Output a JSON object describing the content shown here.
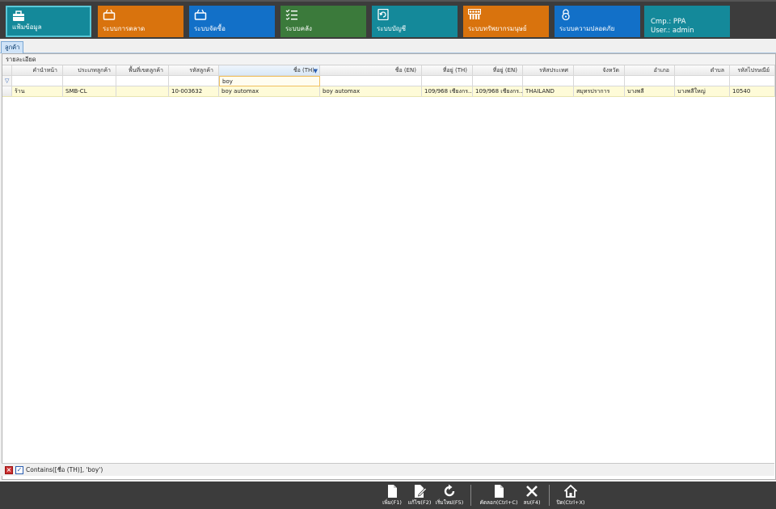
{
  "ribbon": {
    "tiles": [
      {
        "label": "แฟ้มข้อมูล",
        "icon": "briefcase-icon",
        "color": "#14899a"
      },
      {
        "label": "ระบบการตลาด",
        "icon": "basket-icon",
        "color": "#d9730d"
      },
      {
        "label": "ระบบจัดซื้อ",
        "icon": "basket-icon",
        "color": "#1270c8"
      },
      {
        "label": "ระบบคลัง",
        "icon": "checklist-icon",
        "color": "#3b7a3b"
      },
      {
        "label": "ระบบบัญชี",
        "icon": "refresh-doc-icon",
        "color": "#14899a"
      },
      {
        "label": "ระบบทรัพยากรมนุษย์",
        "icon": "people-icon",
        "color": "#d9730d"
      },
      {
        "label": "ระบบความปลอดภัย",
        "icon": "lock-icon",
        "color": "#1270c8"
      }
    ],
    "company": {
      "cmp": "Cmp.: PPA",
      "user": "User.: admin",
      "color": "#14899a"
    }
  },
  "tabs": [
    {
      "label": "ลูกค้า"
    }
  ],
  "group_caption": "รายละเอียด",
  "grid": {
    "columns": [
      {
        "label": "คำนำหน้า"
      },
      {
        "label": "ประเภทลูกค้า"
      },
      {
        "label": "พื้นที่เขตลูกค้า"
      },
      {
        "label": "รหัสลูกค้า"
      },
      {
        "label": "ชื่อ (TH)"
      },
      {
        "label": "ชื่อ (EN)"
      },
      {
        "label": "ที่อยู่ (TH)"
      },
      {
        "label": "ที่อยู่ (EN)"
      },
      {
        "label": "รหัสประเทศ"
      },
      {
        "label": "จังหวัด"
      },
      {
        "label": "อำเภอ"
      },
      {
        "label": "ตำบล"
      },
      {
        "label": "รหัสไปรษณีย์"
      }
    ],
    "filter_value": "boy",
    "rows": [
      [
        "ร้าน",
        "SMB-CL",
        "",
        "10-003632",
        "boy automax",
        "boy automax",
        "109/968 เชียงกร...",
        "109/968 เชียงกร...",
        "THAILAND",
        "สมุทรปราการ",
        "บางพลี",
        "บางพลีใหญ่",
        "10540"
      ]
    ]
  },
  "filter_bar": {
    "text": "Contains([ชื่อ (TH)], 'boy')"
  },
  "toolbar": [
    {
      "label": "เพิ่ม(F1)",
      "icon": "new-doc-icon"
    },
    {
      "label": "แก้ไข(F2)",
      "icon": "edit-doc-icon"
    },
    {
      "label": "เริ่มใหม่(F5)",
      "icon": "refresh-icon"
    },
    {
      "label": "คัดลอก(Ctrl+C)",
      "icon": "copy-doc-icon"
    },
    {
      "label": "ลบ(F4)",
      "icon": "delete-x-icon"
    },
    {
      "label": "ปิด(Ctrl+X)",
      "icon": "home-icon"
    }
  ]
}
